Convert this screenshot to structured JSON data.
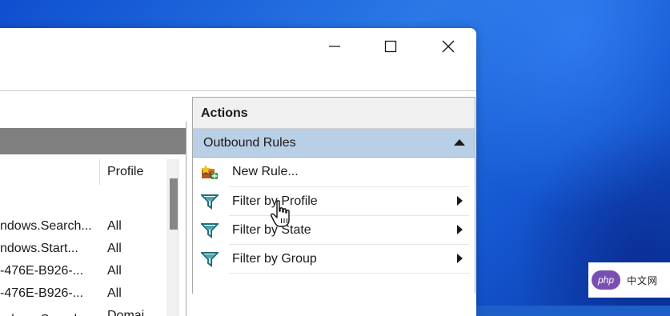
{
  "window": {
    "controls": {
      "minimize": "minimize",
      "maximize": "maximize",
      "close": "close"
    }
  },
  "left_table": {
    "profile_header": "Profile",
    "rows": [
      {
        "name": "ndows.Search...",
        "profile": "All"
      },
      {
        "name": "ndows.Start...",
        "profile": "All"
      },
      {
        "name": "-476E-B926-...",
        "profile": "All"
      },
      {
        "name": "-476E-B926-...",
        "profile": "All"
      },
      {
        "name": "",
        "profile": "Domai"
      }
    ]
  },
  "actions": {
    "title": "Actions",
    "section": {
      "label": "Outbound Rules",
      "state": "expanded"
    },
    "items": [
      {
        "label": "New Rule...",
        "icon": "new-rule-icon",
        "submenu": false
      },
      {
        "label": "Filter by Profile",
        "icon": "filter-icon",
        "submenu": true
      },
      {
        "label": "Filter by State",
        "icon": "filter-icon",
        "submenu": true
      },
      {
        "label": "Filter by Group",
        "icon": "filter-icon",
        "submenu": true
      }
    ]
  },
  "watermark": {
    "logo": "php",
    "text": "中文网"
  },
  "colors": {
    "desktop": "#1d5fc8",
    "section_header": "#b9cfe6",
    "left_header": "#808080",
    "filter_icon": "#1e6f7a"
  }
}
